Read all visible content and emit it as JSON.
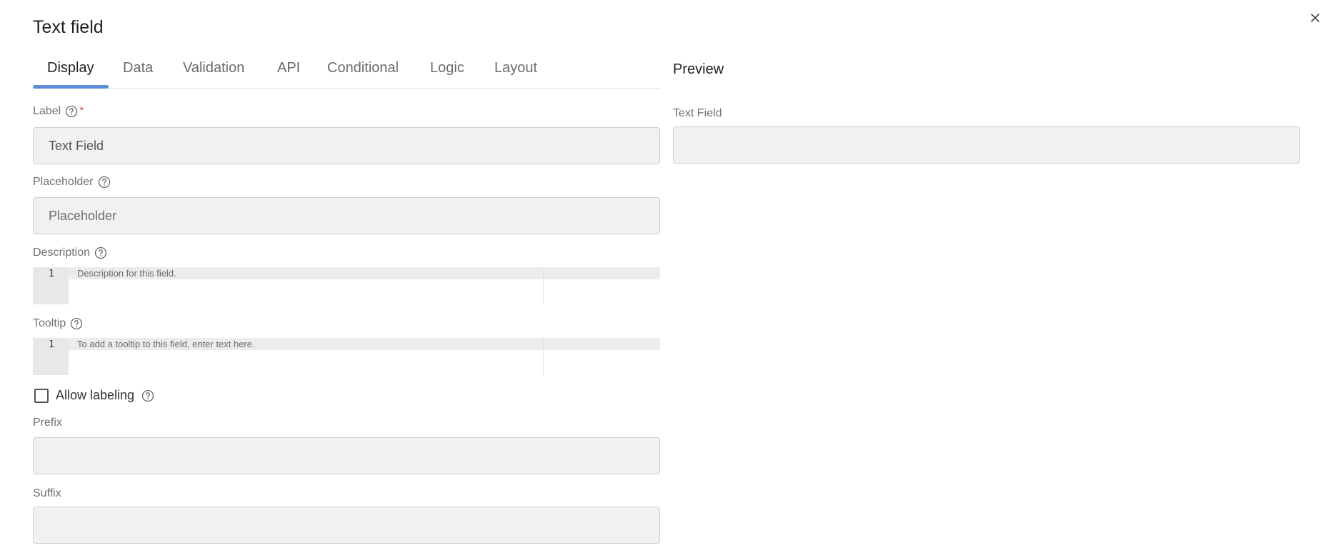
{
  "dialog": {
    "title": "Text field",
    "close_icon": "close-icon"
  },
  "tabs": [
    {
      "label": "Display",
      "active": true
    },
    {
      "label": "Data"
    },
    {
      "label": "Validation"
    },
    {
      "label": "API"
    },
    {
      "label": "Conditional"
    },
    {
      "label": "Logic"
    },
    {
      "label": "Layout"
    }
  ],
  "form": {
    "label": {
      "label": "Label",
      "required_mark": "*",
      "value": "Text Field"
    },
    "placeholder": {
      "label": "Placeholder",
      "placeholder": "Placeholder"
    },
    "description": {
      "label": "Description",
      "line_number": "1",
      "text": "Description for this field."
    },
    "tooltip": {
      "label": "Tooltip",
      "line_number": "1",
      "text": "To add a tooltip to this field, enter text here."
    },
    "allow_labeling": {
      "label": "Allow labeling",
      "checked": false
    },
    "prefix": {
      "label": "Prefix"
    },
    "suffix": {
      "label": "Suffix"
    }
  },
  "preview": {
    "title": "Preview",
    "field_label": "Text Field"
  },
  "colors": {
    "accent": "#5b8dd9",
    "required": "#d9534f",
    "input_bg": "#f1f1f1"
  }
}
